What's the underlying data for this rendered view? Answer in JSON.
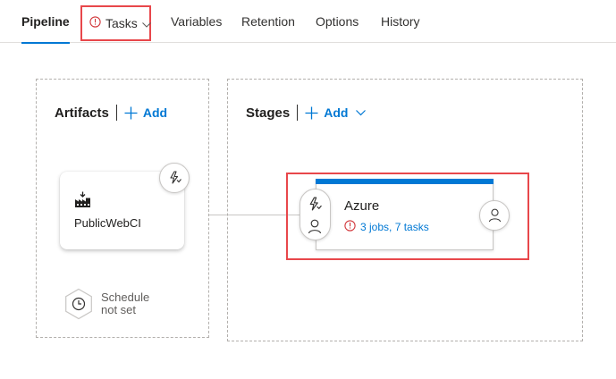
{
  "tabs": [
    {
      "label": "Pipeline",
      "active": true
    },
    {
      "label": "Tasks",
      "warning": true
    },
    {
      "label": "Variables"
    },
    {
      "label": "Retention"
    },
    {
      "label": "Options"
    },
    {
      "label": "History"
    }
  ],
  "artifacts": {
    "title": "Artifacts",
    "add_label": "Add",
    "items": [
      {
        "name": "PublicWebCI",
        "icon": "build-artifact-icon"
      }
    ],
    "schedule": {
      "line1": "Schedule",
      "line2": "not set",
      "icon": "clock-icon"
    }
  },
  "stages": {
    "title": "Stages",
    "add_label": "Add",
    "items": [
      {
        "name": "Azure",
        "status": "3 jobs, 7 tasks"
      }
    ]
  },
  "colors": {
    "accent": "#0078d4",
    "warning": "#d13438",
    "highlight": "#e8474b"
  }
}
